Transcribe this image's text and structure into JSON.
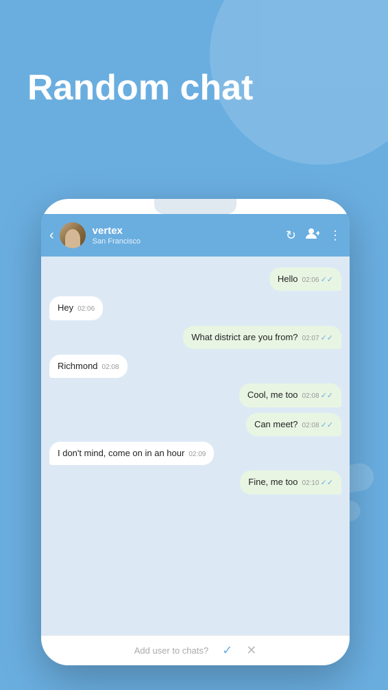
{
  "page": {
    "title": "Random chat",
    "background_color": "#6aaee0"
  },
  "header": {
    "back_label": "‹",
    "user_name": "vertex",
    "user_location": "San Francisco",
    "refresh_icon": "↻",
    "add_user_icon": "👤+",
    "more_icon": "⋮"
  },
  "messages": [
    {
      "id": 1,
      "text": "Hello",
      "time": "02:06",
      "type": "sent",
      "read": true
    },
    {
      "id": 2,
      "text": "Hey",
      "time": "02:06",
      "type": "received",
      "read": false
    },
    {
      "id": 3,
      "text": "What district are you from?",
      "time": "02:07",
      "type": "sent",
      "read": true
    },
    {
      "id": 4,
      "text": "Richmond",
      "time": "02:08",
      "type": "received",
      "read": false
    },
    {
      "id": 5,
      "text": "Cool, me too",
      "time": "02:08",
      "type": "sent",
      "read": true
    },
    {
      "id": 6,
      "text": "Can meet?",
      "time": "02:08",
      "type": "sent",
      "read": true
    },
    {
      "id": 7,
      "text": "I don't mind, come on in an hour",
      "time": "02:09",
      "type": "received",
      "read": false
    },
    {
      "id": 8,
      "text": "Fine, me too",
      "time": "02:10",
      "type": "sent",
      "read": true
    }
  ],
  "bottom_bar": {
    "prompt": "Add user to chats?",
    "confirm_label": "✓",
    "cancel_label": "✕"
  }
}
